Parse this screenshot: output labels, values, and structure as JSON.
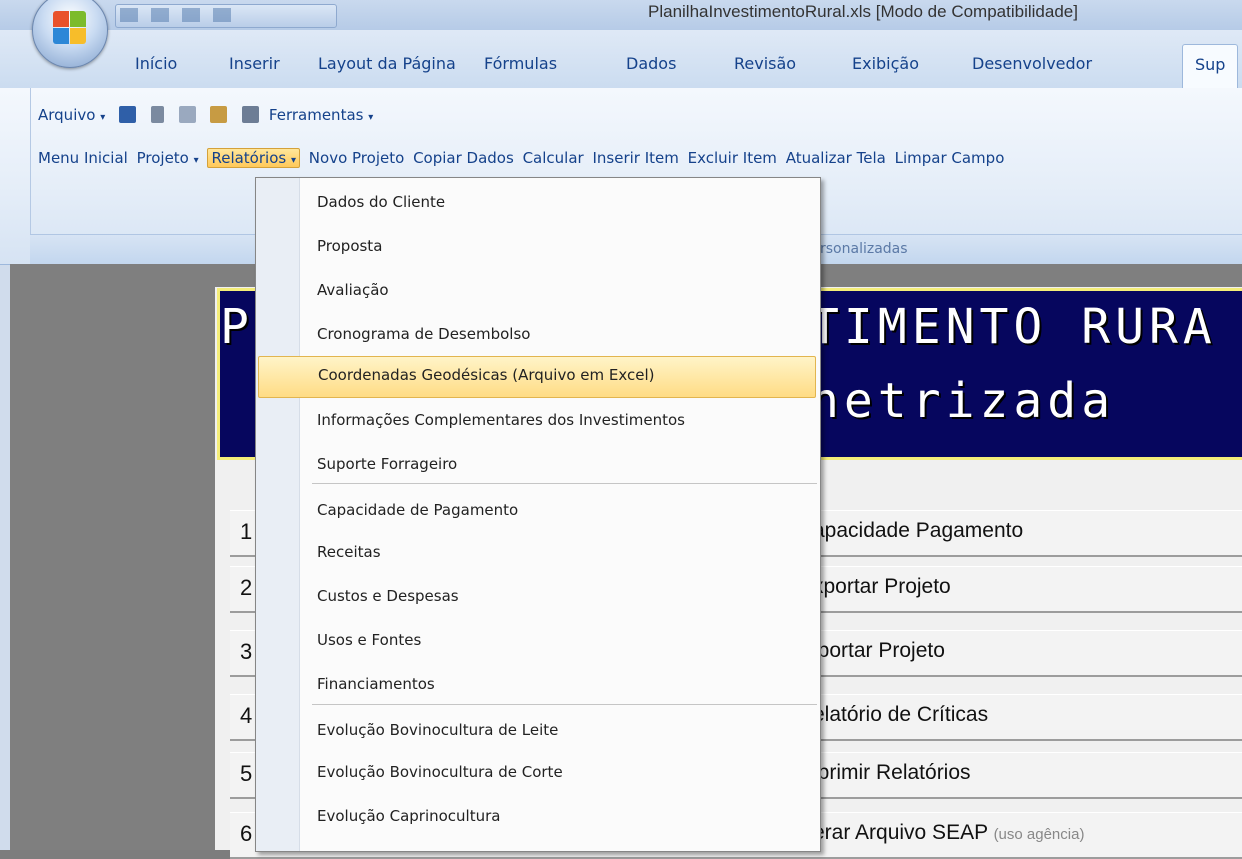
{
  "window": {
    "title": "PlanilhaInvestimentoRural.xls  [Modo de Compatibilidade]"
  },
  "ribbon_tabs": [
    "Início",
    "Inserir",
    "Layout da Página",
    "Fórmulas",
    "Dados",
    "Revisão",
    "Exibição",
    "Desenvolvedor",
    "Sup"
  ],
  "toolbar_row1": {
    "arquivo": "Arquivo",
    "ferramentas": "Ferramentas"
  },
  "toolbar_row2": [
    "Menu Inicial",
    "Projeto",
    "Relatórios",
    "Novo Projeto",
    "Copiar Dados",
    "Calcular",
    "Inserir Item",
    "Excluir Item",
    "Atualizar Tela",
    "Limpar Campo"
  ],
  "group_label": "rsonalizadas",
  "banner": {
    "line1_left": "P",
    "line1_right": "TIMENTO RURA",
    "line2": "netrizada"
  },
  "sheet_buttons": [
    {
      "num": "1",
      "label": "apacidade Pagamento",
      "suffix": ""
    },
    {
      "num": "2",
      "label": "xportar Projeto",
      "suffix": ""
    },
    {
      "num": "3",
      "label": "iportar Projeto",
      "suffix": ""
    },
    {
      "num": "4",
      "label": "elatório de Críticas",
      "suffix": ""
    },
    {
      "num": "5",
      "label": "iprimir Relatórios",
      "suffix": ""
    },
    {
      "num": "6",
      "label": "erar Arquivo SEAP",
      "suffix": "(uso agência)"
    }
  ],
  "relatorios_menu": {
    "highlighted": "Coordenadas Geodésicas (Arquivo em Excel)",
    "items": [
      "Dados do Cliente",
      "Proposta",
      "Avaliação",
      "Cronograma de Desembolso",
      "Coordenadas Geodésicas (Arquivo em Excel)",
      "Informações Complementares dos Investimentos",
      "Suporte Forrageiro",
      "Capacidade de Pagamento",
      "Receitas",
      "Custos e Despesas",
      "Usos e Fontes",
      "Financiamentos",
      "Evolução Bovinocultura de Leite",
      "Evolução Bovinocultura de Corte",
      "Evolução Caprinocultura"
    ]
  }
}
